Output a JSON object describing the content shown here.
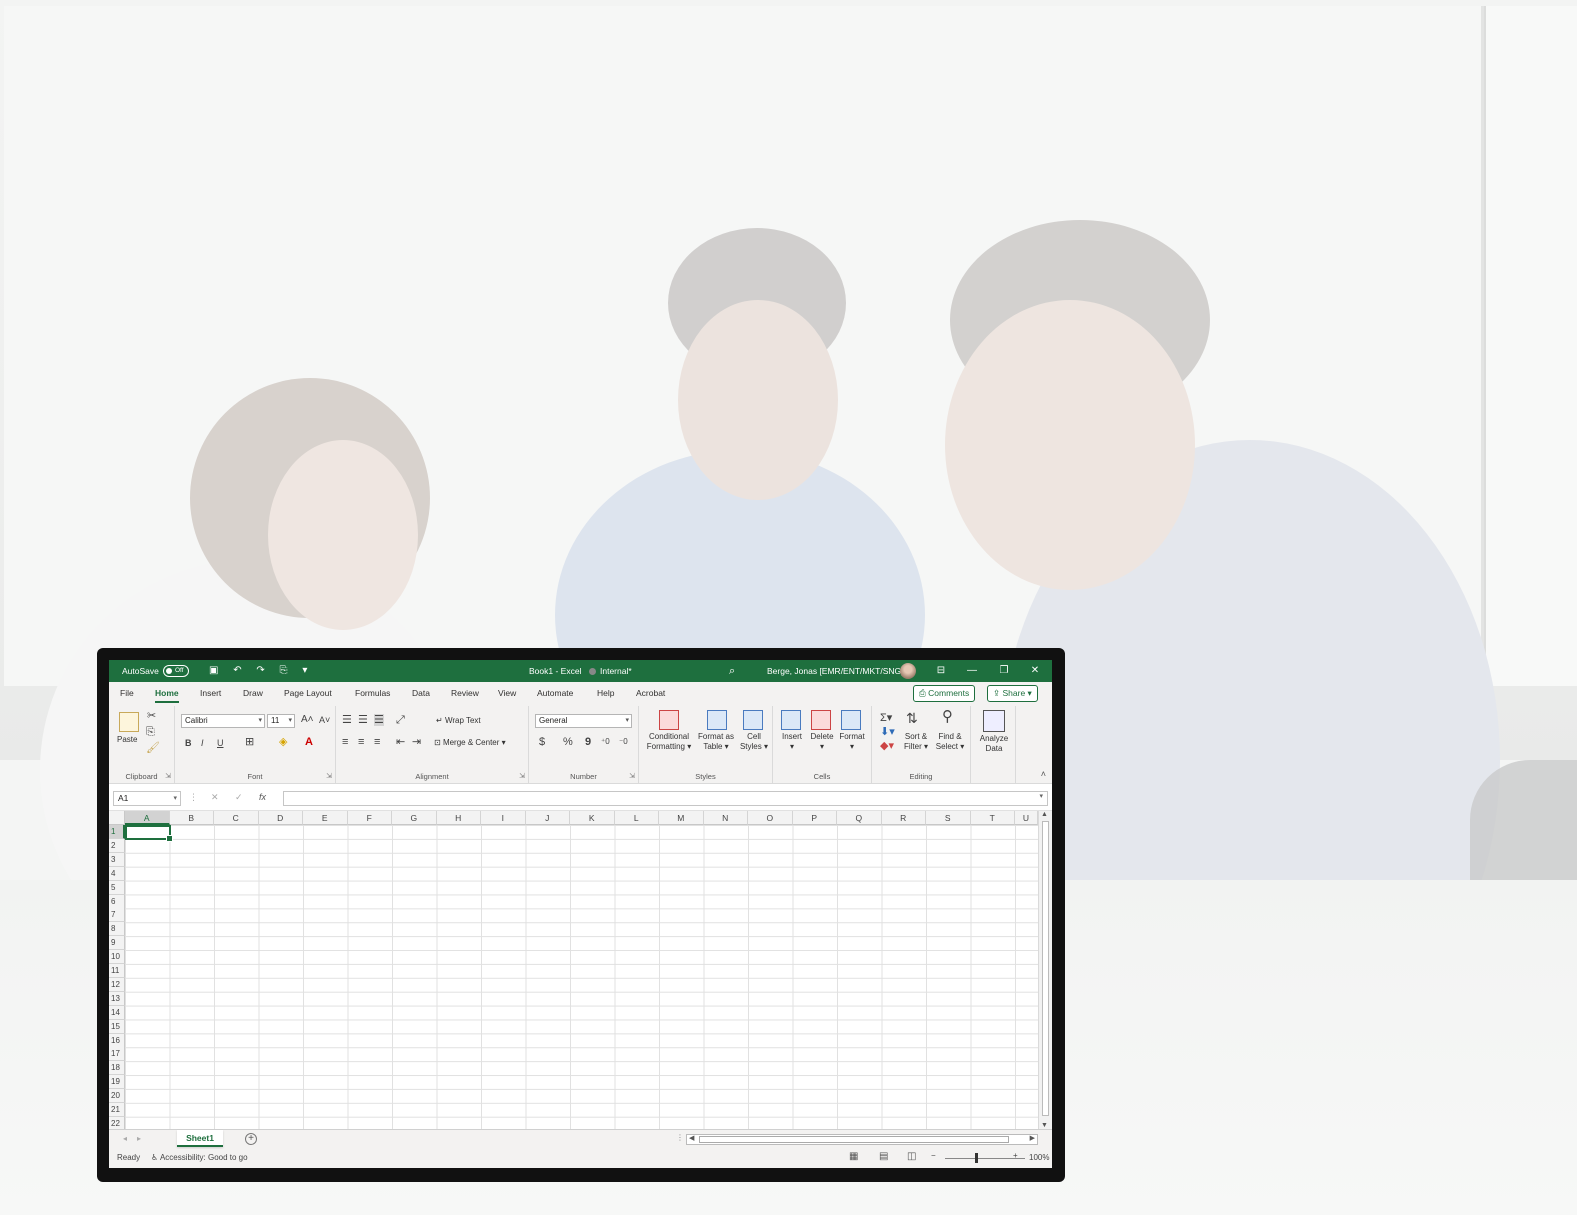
{
  "titlebar": {
    "autosave_label": "AutoSave",
    "autosave_state": "Off",
    "document_title": "Book1 - Excel",
    "sensitivity_label": "Internal*",
    "user_name": "Berge, Jonas [EMR/ENT/MKT/SNG]"
  },
  "tabs": [
    "File",
    "Home",
    "Insert",
    "Draw",
    "Page Layout",
    "Formulas",
    "Data",
    "Review",
    "View",
    "Automate",
    "Help",
    "Acrobat"
  ],
  "tab_active": "Home",
  "actions": {
    "comments": "Comments",
    "share": "Share"
  },
  "ribbon": {
    "clipboard": {
      "label": "Clipboard",
      "paste": "Paste"
    },
    "font": {
      "label": "Font",
      "name": "Calibri",
      "size": "11",
      "bold": "B",
      "italic": "I",
      "underline": "U"
    },
    "alignment": {
      "label": "Alignment",
      "wrap": "Wrap Text",
      "merge": "Merge & Center"
    },
    "number": {
      "label": "Number",
      "format": "General",
      "currency": "$",
      "percent": "%",
      "comma": "9"
    },
    "styles": {
      "label": "Styles",
      "conditional_1": "Conditional",
      "conditional_2": "Formatting",
      "format_table_1": "Format as",
      "format_table_2": "Table",
      "cell_styles_1": "Cell",
      "cell_styles_2": "Styles"
    },
    "cells": {
      "label": "Cells",
      "insert": "Insert",
      "delete": "Delete",
      "format": "Format"
    },
    "editing": {
      "label": "Editing",
      "sort_1": "Sort &",
      "sort_2": "Filter",
      "find_1": "Find &",
      "find_2": "Select"
    },
    "analysis": {
      "analyze_1": "Analyze",
      "analyze_2": "Data"
    }
  },
  "formula_bar": {
    "name_box": "A1",
    "fx": "fx",
    "value": ""
  },
  "columns": [
    "A",
    "B",
    "C",
    "D",
    "E",
    "F",
    "G",
    "H",
    "I",
    "J",
    "K",
    "L",
    "M",
    "N",
    "O",
    "P",
    "Q",
    "R",
    "S",
    "T",
    "U"
  ],
  "rows": [
    "1",
    "2",
    "3",
    "4",
    "5",
    "6",
    "7",
    "8",
    "9",
    "10",
    "11",
    "12",
    "13",
    "14",
    "15",
    "16",
    "17",
    "18",
    "19",
    "20",
    "21",
    "22"
  ],
  "selected_cell": "A1",
  "sheet_tabs": [
    "Sheet1"
  ],
  "status": {
    "ready": "Ready",
    "accessibility": "Accessibility: Good to go",
    "zoom": "100%"
  },
  "colors": {
    "excel_green": "#1e6f3e",
    "ribbon_bg": "#f3f2f1"
  }
}
